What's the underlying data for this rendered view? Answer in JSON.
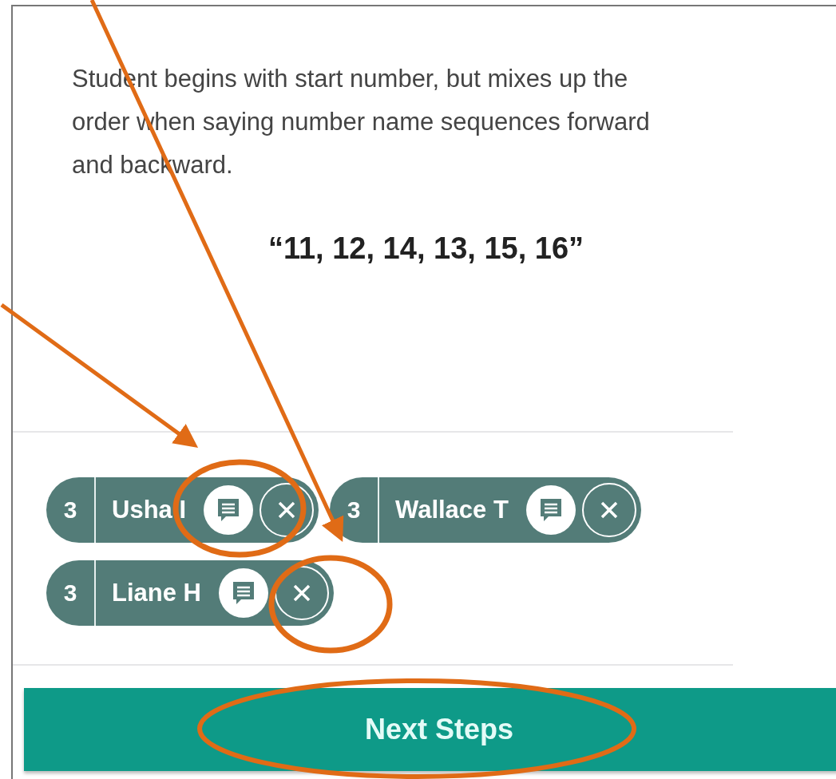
{
  "description": "Student begins with start number, but mixes up the order when saying number name sequences forward and backward.",
  "example": "“11, 12, 14, 13, 15, 16”",
  "students": [
    {
      "count": "3",
      "name": "Usha I"
    },
    {
      "count": "3",
      "name": "Wallace T"
    },
    {
      "count": "3",
      "name": "Liane H"
    }
  ],
  "next_button": {
    "label": "Next Steps"
  }
}
